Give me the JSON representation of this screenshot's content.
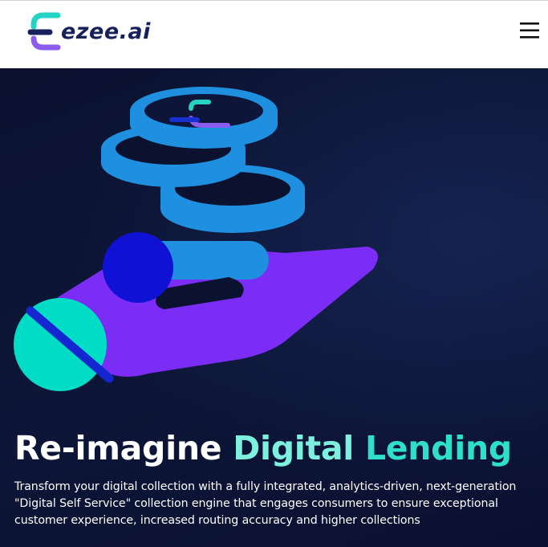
{
  "header": {
    "logo_text": "ezee.ai",
    "logo_icon": "ezee-e-logo-icon",
    "menu_icon": "hamburger-menu-icon"
  },
  "hero": {
    "headline_plain": "Re-imagine",
    "headline_accent_1": "Digital",
    "headline_accent_2": "Lending",
    "description": "Transform your digital collection with a fully integrated, analytics-driven, next-generation \"Digital Self Service\" collection engine that engages consumers to ensure exceptional customer experience, increased routing accuracy and higher collections",
    "illustration_icon": "hand-holding-coins-icon"
  },
  "colors": {
    "header_bg": "#ffffff",
    "hero_bg": "#0d1533",
    "brand_navy": "#16205a",
    "accent_teal": "#2fe0c8",
    "accent_purple": "#7b2cf5",
    "coin_blue": "#1f8fe0"
  }
}
